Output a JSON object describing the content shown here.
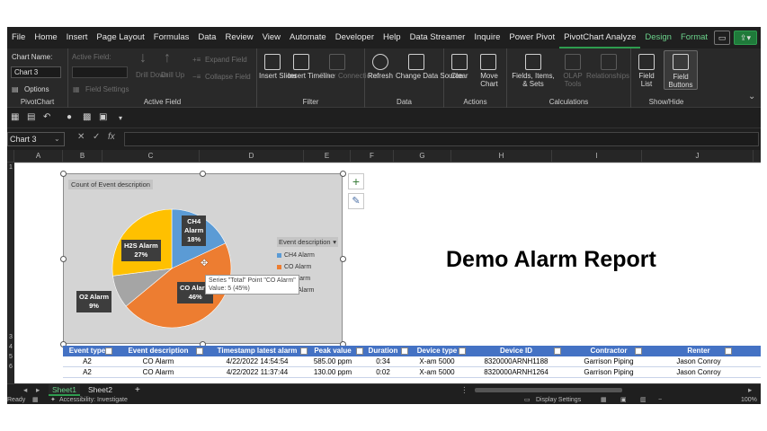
{
  "menu": {
    "items": [
      "File",
      "Home",
      "Insert",
      "Page Layout",
      "Formulas",
      "Data",
      "Review",
      "View",
      "Automate",
      "Developer",
      "Help",
      "Data Streamer",
      "Inquire",
      "Power Pivot",
      "PivotChart Analyze",
      "Design",
      "Format"
    ],
    "active": "PivotChart Analyze"
  },
  "ribbon": {
    "pivotchart": {
      "chart_name_label": "Chart Name:",
      "chart_name_value": "Chart 3",
      "options_label": "Options",
      "group_label": "PivotChart"
    },
    "active_field": {
      "label": "Active Field:",
      "field_settings": "Field Settings",
      "drill_down": "Drill Down",
      "drill_up": "Drill Up",
      "expand_field": "Expand Field",
      "collapse_field": "Collapse Field",
      "group_label": "Active Field"
    },
    "filter": {
      "insert_slicer": "Insert Slicer",
      "insert_timeline": "Insert Timeline",
      "filter_connections": "Filter Connections",
      "group_label": "Filter"
    },
    "data": {
      "refresh": "Refresh",
      "change_data_source": "Change Data Source",
      "group_label": "Data"
    },
    "actions": {
      "clear": "Clear",
      "move_chart": "Move Chart",
      "group_label": "Actions"
    },
    "calculations": {
      "fields_items_sets": "Fields, Items, & Sets",
      "olap_tools": "OLAP Tools",
      "relationships": "Relationships",
      "group_label": "Calculations"
    },
    "show_hide": {
      "field_list": "Field List",
      "field_buttons": "Field Buttons",
      "group_label": "Show/Hide"
    }
  },
  "formula_bar": {
    "name_box": "Chart 3",
    "fx": "fx",
    "value": ""
  },
  "columns": [
    "A",
    "B",
    "C",
    "D",
    "E",
    "F",
    "G",
    "H",
    "I",
    "J"
  ],
  "report": {
    "title": "Demo Alarm Report"
  },
  "chart_data": {
    "type": "pie",
    "title": "Count of Event description",
    "categories": [
      "CH4 Alarm",
      "CO Alarm",
      "O2 Alarm",
      "H2S Alarm"
    ],
    "values": [
      18,
      46,
      9,
      27
    ],
    "unit": "%",
    "colors": [
      "#5b9bd5",
      "#ed7d31",
      "#a5a5a5",
      "#ffc000"
    ],
    "legend_title": "Event description",
    "legend_items": [
      "CH4 Alarm",
      "CO Alarm",
      "O2 Alarm",
      "H2S Alarm"
    ],
    "legend_position": "right",
    "data_labels": [
      {
        "name": "CH4",
        "line2": "Alarm",
        "pct": "18%"
      },
      {
        "name": "CO Alarm",
        "pct": "46%"
      },
      {
        "name": "O2 Alarm",
        "pct": "9%"
      },
      {
        "name": "H2S Alarm",
        "pct": "27%"
      }
    ],
    "tooltip": {
      "line1": "Series \"Total\" Point \"CO Alarm\"",
      "line2": "Value: 5 (45%)"
    }
  },
  "table": {
    "headers": [
      "Event type",
      "Event description",
      "Timestamp latest alarm",
      "Peak value",
      "Duration",
      "Device type",
      "Device ID",
      "Contractor",
      "Renter"
    ],
    "rows": [
      [
        "A2",
        "CO Alarm",
        "4/22/2022 14:54:54",
        "585.00 ppm",
        "0:34",
        "X-am 5000",
        "8320000ARNH1188",
        "Garrison Piping",
        "Jason Conroy"
      ],
      [
        "A2",
        "CO Alarm",
        "4/22/2022 11:37:44",
        "130.00 ppm",
        "0:02",
        "X-am 5000",
        "8320000ARNH1264",
        "Garrison Piping",
        "Jason Conroy"
      ]
    ]
  },
  "sheets": {
    "tabs": [
      "Sheet1",
      "Sheet2"
    ],
    "active": "Sheet1",
    "add": "+"
  },
  "status": {
    "ready": "Ready",
    "accessibility": "Accessibility: Investigate",
    "display_settings": "Display Settings",
    "zoom": "100%"
  }
}
